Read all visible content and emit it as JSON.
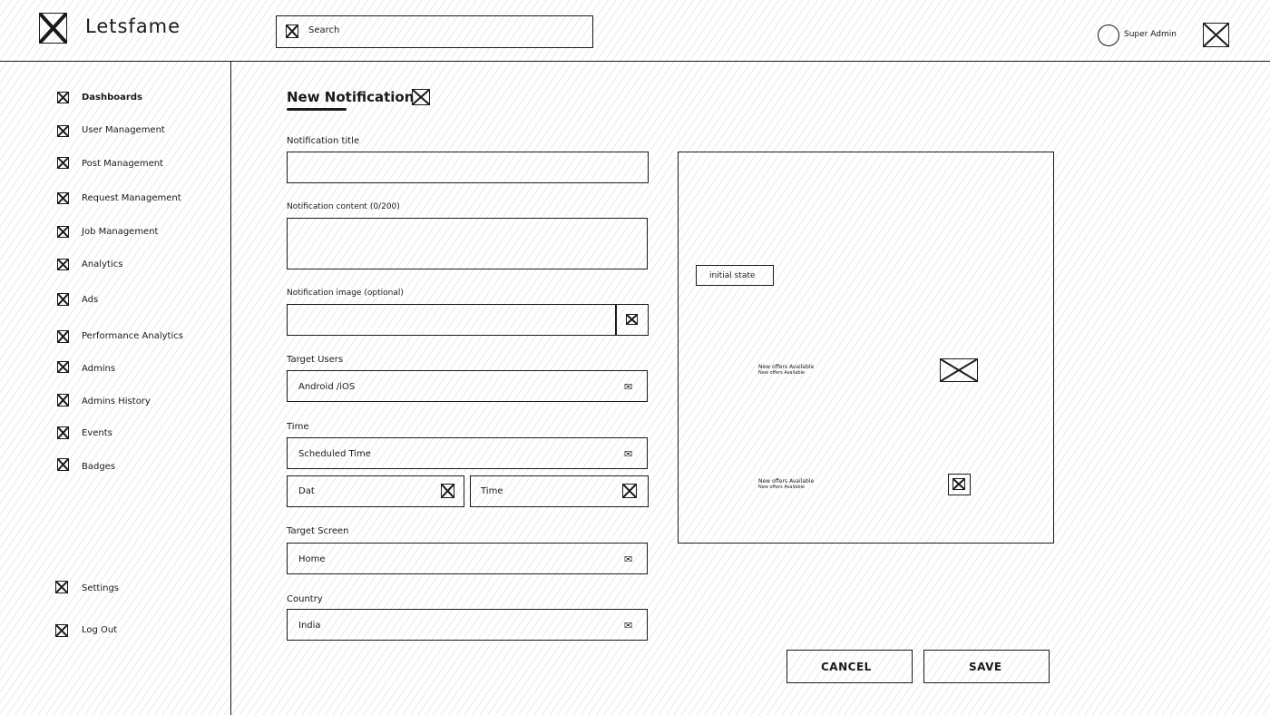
{
  "app": {
    "title": "Letsfame"
  },
  "search": {
    "label": "Search"
  },
  "user": {
    "name": "Super Admin"
  },
  "sidebar": {
    "items": [
      {
        "label": "Dashboards",
        "active": true
      },
      {
        "label": "User Management"
      },
      {
        "label": "Post Management"
      },
      {
        "label": "Request Management"
      },
      {
        "label": "Job Management"
      },
      {
        "label": "Analytics"
      },
      {
        "label": "Ads"
      },
      {
        "label": "Performance Analytics"
      },
      {
        "label": "Admins"
      },
      {
        "label": "Admins History"
      },
      {
        "label": "Events"
      },
      {
        "label": "Badges"
      }
    ],
    "bottom": [
      {
        "label": "Settings"
      },
      {
        "label": "Log Out"
      }
    ]
  },
  "form": {
    "title": "New Notification",
    "notification_title_label": "Notification title",
    "notification_content_label": "Notification content (0/200)",
    "notification_image_label": "Notification image (optional)",
    "target_users": {
      "label": "Target Users",
      "value": "Android /iOS"
    },
    "time": {
      "label": "Time",
      "value": "Scheduled Time",
      "date_placeholder": "Dat",
      "time_placeholder": "Time"
    },
    "target_screen": {
      "label": "Target Screen",
      "value": "Home"
    },
    "country": {
      "label": "Country",
      "value": "India"
    }
  },
  "preview": {
    "state_label": "initial state",
    "notifications": [
      {
        "title": "New offers Available",
        "subtitle": "New offers Available"
      },
      {
        "title": "New offers Available",
        "subtitle": "New offers Available"
      }
    ]
  },
  "buttons": {
    "cancel": "CANCEL",
    "save": "SAVE"
  },
  "icons": {
    "placeholder": "image-placeholder-icon",
    "dropdown": "envelope-icon",
    "avatar": "avatar-circle"
  }
}
